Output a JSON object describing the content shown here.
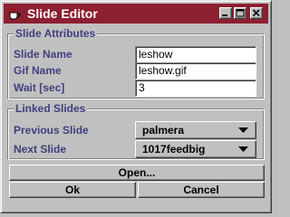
{
  "window": {
    "title": "Slide Editor",
    "icon": "java-coffee-cup-icon",
    "accent_color": "#8c1f30",
    "controls": [
      "minimize-icon",
      "maximize-icon",
      "close-icon"
    ]
  },
  "slide_attributes": {
    "legend": "Slide Attributes",
    "slide_name_label": "Slide Name",
    "slide_name_value": "leshow",
    "gif_name_label": "Gif Name",
    "gif_name_value": "leshow.gif",
    "wait_label": "Wait [sec]",
    "wait_value": "3"
  },
  "linked_slides": {
    "legend": "Linked Slides",
    "previous_label": "Previous Slide",
    "previous_value": "palmera",
    "next_label": "Next Slide",
    "next_value": "1017feedbig"
  },
  "buttons": {
    "open": "Open...",
    "ok": "Ok",
    "cancel": "Cancel"
  },
  "colors": {
    "label_text": "#404080",
    "face": "#c0c0c0"
  }
}
